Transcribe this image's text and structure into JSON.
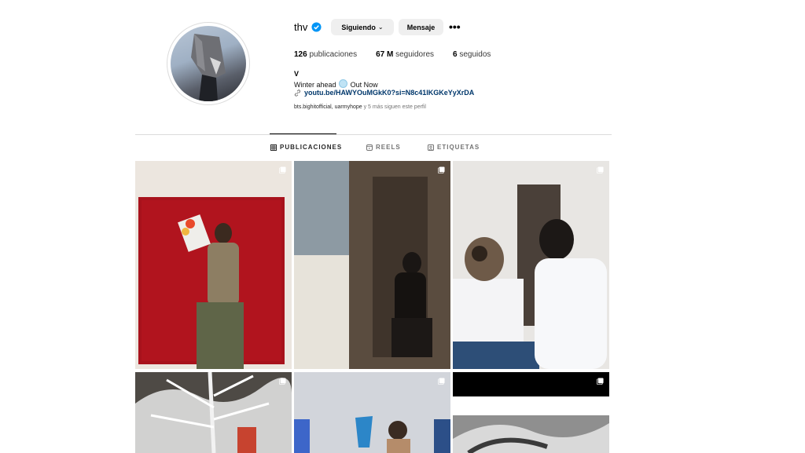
{
  "profile": {
    "username": "thv",
    "follow_button": "Siguiendo",
    "message_button": "Mensaje",
    "more_icon": "more-icon",
    "stats": {
      "posts_count": "126",
      "posts_label": "publicaciones",
      "followers_count": "67 M",
      "followers_label": "seguidores",
      "following_count": "6",
      "following_label": "seguidos"
    },
    "bio": {
      "name": "V",
      "text_before": "Winter ahead",
      "text_after": "Out Now",
      "link": "youtu.be/HAWYOuMGkK0?si=N8c41IKGKeYyXrDA"
    },
    "followed_by": {
      "accounts": "bts.bighitofficial, uarmyhope",
      "suffix": "y 5 más siguen este perfil"
    }
  },
  "tabs": [
    {
      "label": "PUBLICACIONES",
      "active": true,
      "icon": "grid-icon"
    },
    {
      "label": "REELS",
      "active": false,
      "icon": "reels-icon"
    },
    {
      "label": "ETIQUETAS",
      "active": false,
      "icon": "tag-icon"
    }
  ],
  "colors": {
    "verified": "#0095f6",
    "link": "#00376b",
    "button_bg": "#efefef"
  }
}
